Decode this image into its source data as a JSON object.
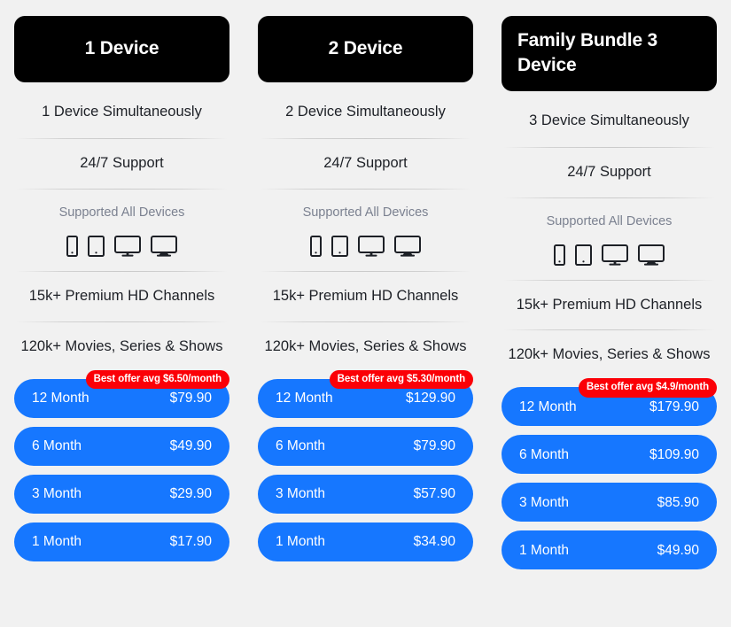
{
  "page": {
    "background_color": "#f1f1f1",
    "accent_blue": "#1677ff",
    "badge_red": "#fb0007",
    "header_black": "#000000"
  },
  "plans": [
    {
      "title": "1 Device",
      "features": {
        "simultaneous": "1 Device Simultaneously",
        "support": "24/7 Support",
        "devices_label": "Supported All Devices",
        "channels": "15k+ Premium HD Channels",
        "movies": "120k+ Movies, Series & Shows"
      },
      "device_icons": [
        "phone-icon",
        "tablet-icon",
        "monitor-icon",
        "tv-icon"
      ],
      "best_offer_badge": "Best offer avg $6.50/month",
      "prices": [
        {
          "term": "12 Month",
          "amount": "$79.90"
        },
        {
          "term": "6 Month",
          "amount": "$49.90"
        },
        {
          "term": "3 Month",
          "amount": "$29.90"
        },
        {
          "term": "1 Month",
          "amount": "$17.90"
        }
      ]
    },
    {
      "title": "2 Device",
      "features": {
        "simultaneous": "2 Device Simultaneously",
        "support": "24/7 Support",
        "devices_label": "Supported All Devices",
        "channels": "15k+ Premium HD Channels",
        "movies": "120k+ Movies, Series & Shows"
      },
      "device_icons": [
        "phone-icon",
        "tablet-icon",
        "monitor-icon",
        "tv-icon"
      ],
      "best_offer_badge": "Best offer avg $5.30/month",
      "prices": [
        {
          "term": "12 Month",
          "amount": "$129.90"
        },
        {
          "term": "6 Month",
          "amount": "$79.90"
        },
        {
          "term": "3 Month",
          "amount": "$57.90"
        },
        {
          "term": "1 Month",
          "amount": "$34.90"
        }
      ]
    },
    {
      "title": "Family Bundle 3 Device",
      "features": {
        "simultaneous": "3 Device Simultaneously",
        "support": "24/7 Support",
        "devices_label": "Supported All Devices",
        "channels": "15k+ Premium HD Channels",
        "movies": "120k+ Movies, Series & Shows"
      },
      "device_icons": [
        "phone-icon",
        "tablet-icon",
        "monitor-icon",
        "tv-icon"
      ],
      "best_offer_badge": "Best offer avg $4.9/month",
      "prices": [
        {
          "term": "12 Month",
          "amount": "$179.90"
        },
        {
          "term": "6 Month",
          "amount": "$109.90"
        },
        {
          "term": "3 Month",
          "amount": "$85.90"
        },
        {
          "term": "1 Month",
          "amount": "$49.90"
        }
      ]
    }
  ]
}
